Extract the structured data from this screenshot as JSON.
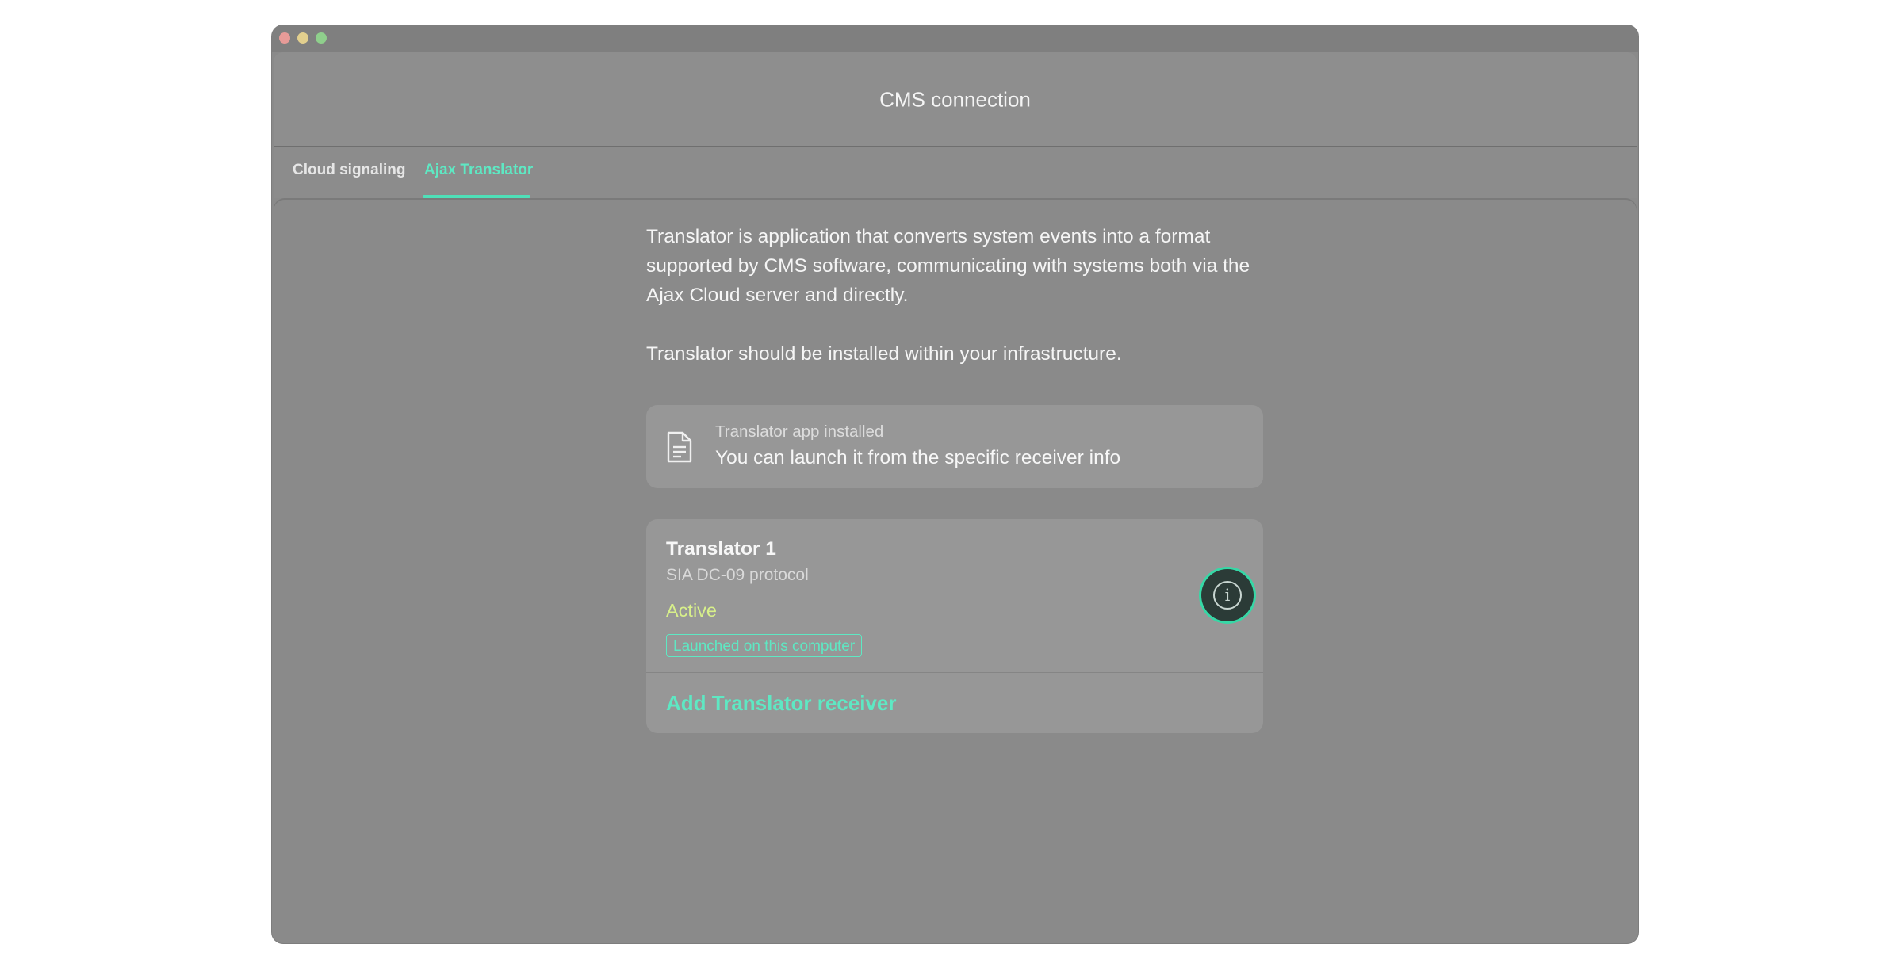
{
  "window": {
    "title": "CMS connection"
  },
  "tabs": [
    {
      "label": "Cloud signaling",
      "active": false
    },
    {
      "label": "Ajax Translator",
      "active": true
    }
  ],
  "content": {
    "description": "Translator is application that converts system events into a format supported by CMS software, communicating with systems both via the Ajax Cloud server and directly.",
    "install_note": "Translator should be installed within your infrastructure."
  },
  "notice": {
    "icon": "document-icon",
    "title": "Translator app installed",
    "message": "You can launch it from the specific receiver info"
  },
  "translator": {
    "name": "Translator 1",
    "protocol": "SIA DC-09 protocol",
    "status": "Active",
    "badge": "Launched on this computer",
    "info_icon": "info-icon"
  },
  "actions": {
    "add_receiver": "Add Translator receiver"
  },
  "colors": {
    "accent": "#5ee8c3",
    "status_active": "#d8f08a",
    "background": "#8a8a8a"
  }
}
